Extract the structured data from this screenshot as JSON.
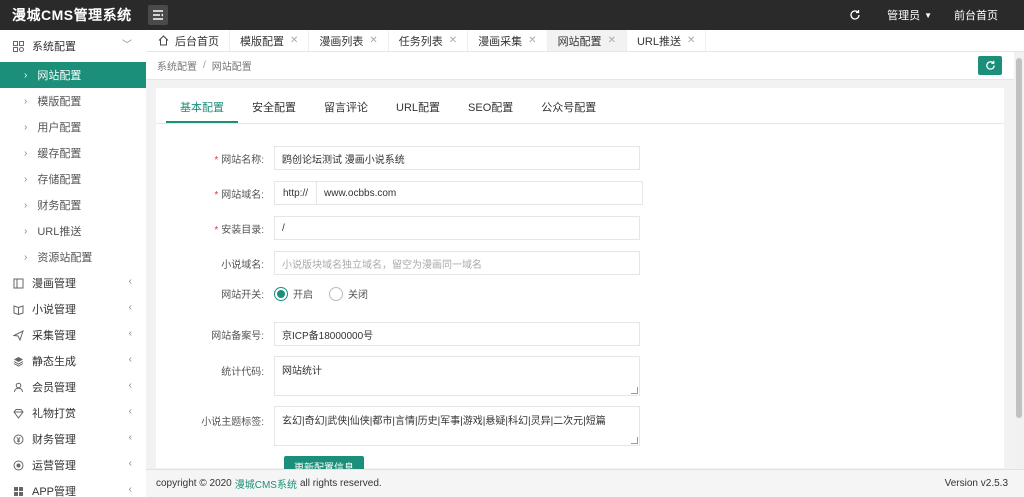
{
  "app": {
    "title": "漫城CMS管理系统"
  },
  "topbar": {
    "admin_label": "管理员",
    "front_label": "前台首页"
  },
  "sidebar": {
    "groups": [
      {
        "label": "系统配置",
        "icon": "gear-icon",
        "expanded": true
      },
      {
        "label": "漫画管理",
        "icon": "book-icon"
      },
      {
        "label": "小说管理",
        "icon": "open-book-icon"
      },
      {
        "label": "采集管理",
        "icon": "send-icon"
      },
      {
        "label": "静态生成",
        "icon": "layers-icon"
      },
      {
        "label": "会员管理",
        "icon": "user-icon"
      },
      {
        "label": "礼物打赏",
        "icon": "gem-icon"
      },
      {
        "label": "财务管理",
        "icon": "yen-icon"
      },
      {
        "label": "运营管理",
        "icon": "target-icon"
      },
      {
        "label": "APP管理",
        "icon": "grid-icon"
      }
    ],
    "sub_items": [
      "网站配置",
      "模版配置",
      "用户配置",
      "缓存配置",
      "存储配置",
      "财务配置",
      "URL推送",
      "资源站配置"
    ],
    "active_sub": "网站配置"
  },
  "tabs": [
    {
      "label": "后台首页",
      "icon": "home-icon"
    },
    {
      "label": "模版配置"
    },
    {
      "label": "漫画列表"
    },
    {
      "label": "任务列表"
    },
    {
      "label": "漫画采集"
    },
    {
      "label": "网站配置",
      "active": true
    },
    {
      "label": "URL推送"
    }
  ],
  "breadcrumb": {
    "parent": "系统配置",
    "sep": "/",
    "current": "网站配置"
  },
  "panel_tabs": [
    "基本配置",
    "安全配置",
    "留言评论",
    "URL配置",
    "SEO配置",
    "公众号配置"
  ],
  "form": {
    "site_name": {
      "label": "网站名称:",
      "value": "鸥创论坛测试 漫画小说系统"
    },
    "site_domain": {
      "label": "网站域名:",
      "prefix": "http://",
      "value": "www.ocbbs.com"
    },
    "install_dir": {
      "label": "安装目录:",
      "value": "/"
    },
    "novel_domain": {
      "label": "小说域名:",
      "placeholder": "小说版块域名独立域名，留空为漫画同一域名"
    },
    "site_switch": {
      "label": "网站开关:",
      "on_label": "开启",
      "off_label": "关闭",
      "value": "on"
    },
    "icp": {
      "label": "网站备案号:",
      "value": "京ICP备18000000号"
    },
    "stats": {
      "label": "统计代码:",
      "value": "网站统计"
    },
    "novel_tags": {
      "label": "小说主题标签:",
      "value": "玄幻|奇幻|武侠|仙侠|都市|言情|历史|军事|游戏|悬疑|科幻|灵异|二次元|短篇"
    },
    "submit_label": "更新配置信息",
    "required_mark": "*"
  },
  "footer": {
    "prefix": "copyright © 2020",
    "link": "漫城CMS系统",
    "suffix": "all rights reserved.",
    "version": "Version v2.5.3"
  },
  "colors": {
    "accent": "#1b8f79",
    "topbar": "#2a2a2a"
  }
}
